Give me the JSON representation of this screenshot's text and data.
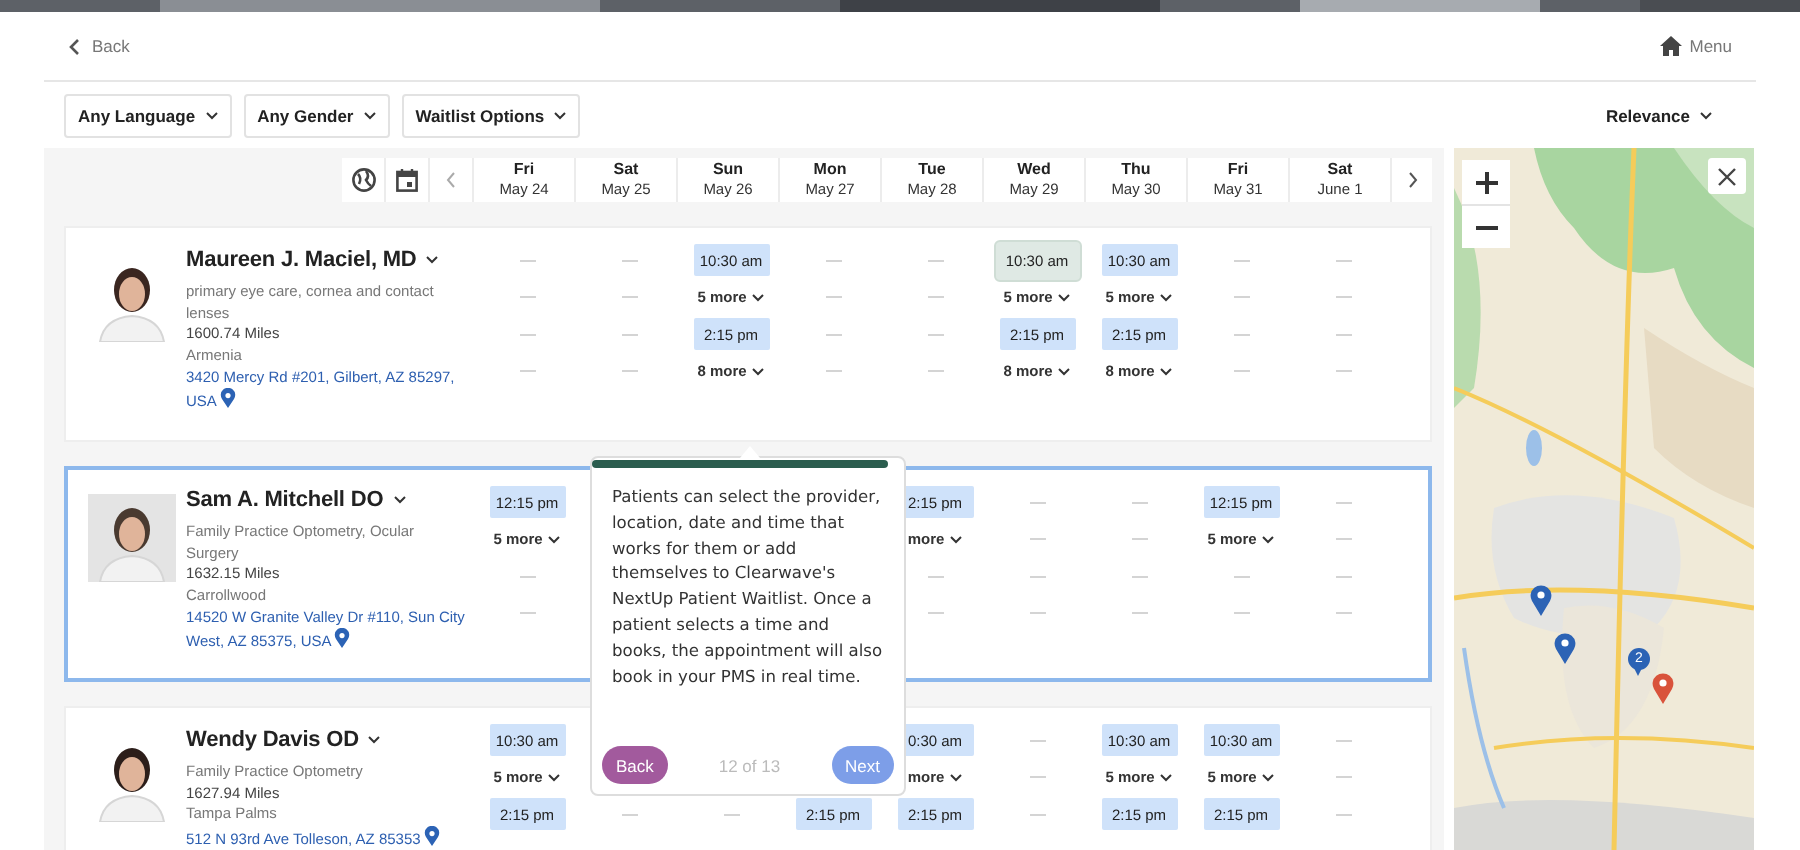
{
  "header": {
    "back": "Back",
    "menu": "Menu"
  },
  "filters": [
    {
      "label": "Any Language"
    },
    {
      "label": "Any Gender"
    },
    {
      "label": "Waitlist Options"
    }
  ],
  "sort": {
    "label": "Relevance"
  },
  "dates": [
    {
      "weekday": "Fri",
      "date": "May 24"
    },
    {
      "weekday": "Sat",
      "date": "May 25"
    },
    {
      "weekday": "Sun",
      "date": "May 26"
    },
    {
      "weekday": "Mon",
      "date": "May 27"
    },
    {
      "weekday": "Tue",
      "date": "May 28"
    },
    {
      "weekday": "Wed",
      "date": "May 29"
    },
    {
      "weekday": "Thu",
      "date": "May 30"
    },
    {
      "weekday": "Fri",
      "date": "May 31"
    },
    {
      "weekday": "Sat",
      "date": "June 1"
    }
  ],
  "providers": [
    {
      "name": "Maureen J. Maciel, MD",
      "selected": false,
      "specialty": "primary eye care, cornea and contact lenses",
      "distance": "1600.74 Miles",
      "area": "Armenia",
      "address": "3420 Mercy Rd #201, Gilbert, AZ 85297, USA",
      "days": [
        {
          "items": [
            {
              "kind": "dash"
            },
            {
              "kind": "dash"
            },
            {
              "kind": "dash"
            },
            {
              "kind": "dash"
            }
          ]
        },
        {
          "items": [
            {
              "kind": "dash"
            },
            {
              "kind": "dash"
            },
            {
              "kind": "dash"
            },
            {
              "kind": "dash"
            }
          ]
        },
        {
          "items": [
            {
              "kind": "slot",
              "time": "10:30 am",
              "selected": false
            },
            {
              "kind": "more",
              "label": "5 more"
            },
            {
              "kind": "slot",
              "time": "2:15 pm",
              "selected": false
            },
            {
              "kind": "more",
              "label": "8 more"
            }
          ]
        },
        {
          "items": [
            {
              "kind": "dash"
            },
            {
              "kind": "dash"
            },
            {
              "kind": "dash"
            },
            {
              "kind": "dash"
            }
          ]
        },
        {
          "items": [
            {
              "kind": "dash"
            },
            {
              "kind": "dash"
            },
            {
              "kind": "dash"
            },
            {
              "kind": "dash"
            }
          ]
        },
        {
          "items": [
            {
              "kind": "slot",
              "time": "10:30 am",
              "selected": true
            },
            {
              "kind": "more",
              "label": "5 more"
            },
            {
              "kind": "slot",
              "time": "2:15 pm",
              "selected": false
            },
            {
              "kind": "more",
              "label": "8 more"
            }
          ]
        },
        {
          "items": [
            {
              "kind": "slot",
              "time": "10:30 am",
              "selected": false
            },
            {
              "kind": "more",
              "label": "5 more"
            },
            {
              "kind": "slot",
              "time": "2:15 pm",
              "selected": false
            },
            {
              "kind": "more",
              "label": "8 more"
            }
          ]
        },
        {
          "items": [
            {
              "kind": "dash"
            },
            {
              "kind": "dash"
            },
            {
              "kind": "dash"
            },
            {
              "kind": "dash"
            }
          ]
        },
        {
          "items": [
            {
              "kind": "dash"
            },
            {
              "kind": "dash"
            },
            {
              "kind": "dash"
            },
            {
              "kind": "dash"
            }
          ]
        }
      ]
    },
    {
      "name": "Sam A. Mitchell DO",
      "selected": true,
      "specialty": "Family Practice Optometry, Ocular Surgery",
      "distance": "1632.15 Miles",
      "area": "Carrollwood",
      "address": "14520 W Granite Valley Dr #110, Sun City West, AZ 85375, USA",
      "days": [
        {
          "items": [
            {
              "kind": "slot",
              "time": "12:15 pm",
              "selected": false
            },
            {
              "kind": "more",
              "label": "5 more"
            },
            {
              "kind": "dash"
            },
            {
              "kind": "dash"
            }
          ]
        },
        {
          "items": [
            {
              "kind": "covered"
            },
            {
              "kind": "covered"
            },
            {
              "kind": "covered"
            },
            {
              "kind": "covered"
            }
          ]
        },
        {
          "items": [
            {
              "kind": "covered"
            },
            {
              "kind": "covered"
            },
            {
              "kind": "covered"
            },
            {
              "kind": "covered"
            }
          ]
        },
        {
          "items": [
            {
              "kind": "covered"
            },
            {
              "kind": "covered"
            },
            {
              "kind": "covered"
            },
            {
              "kind": "covered"
            }
          ]
        },
        {
          "items": [
            {
              "kind": "slot",
              "time": "2:15 pm",
              "selected": false
            },
            {
              "kind": "more",
              "label": "more"
            },
            {
              "kind": "dash"
            },
            {
              "kind": "dash"
            }
          ]
        },
        {
          "items": [
            {
              "kind": "dash"
            },
            {
              "kind": "dash"
            },
            {
              "kind": "dash"
            },
            {
              "kind": "dash"
            }
          ]
        },
        {
          "items": [
            {
              "kind": "dash"
            },
            {
              "kind": "dash"
            },
            {
              "kind": "dash"
            },
            {
              "kind": "dash"
            }
          ]
        },
        {
          "items": [
            {
              "kind": "slot",
              "time": "12:15 pm",
              "selected": false
            },
            {
              "kind": "more",
              "label": "5 more"
            },
            {
              "kind": "dash"
            },
            {
              "kind": "dash"
            }
          ]
        },
        {
          "items": [
            {
              "kind": "dash"
            },
            {
              "kind": "dash"
            },
            {
              "kind": "dash"
            },
            {
              "kind": "dash"
            }
          ]
        }
      ]
    },
    {
      "name": "Wendy Davis OD",
      "selected": false,
      "specialty": "Family Practice Optometry",
      "distance": "1627.94 Miles",
      "area": "Tampa Palms",
      "address": "512 N 93rd Ave Tolleson, AZ 85353",
      "days": [
        {
          "items": [
            {
              "kind": "slot",
              "time": "10:30 am",
              "selected": false
            },
            {
              "kind": "more",
              "label": "5 more"
            },
            {
              "kind": "slot",
              "time": "2:15 pm",
              "selected": false
            }
          ]
        },
        {
          "items": [
            {
              "kind": "covered"
            },
            {
              "kind": "covered"
            },
            {
              "kind": "dash"
            }
          ]
        },
        {
          "items": [
            {
              "kind": "covered"
            },
            {
              "kind": "covered"
            },
            {
              "kind": "dash"
            }
          ]
        },
        {
          "items": [
            {
              "kind": "covered"
            },
            {
              "kind": "covered"
            },
            {
              "kind": "slot",
              "time": "2:15 pm",
              "selected": false
            }
          ]
        },
        {
          "items": [
            {
              "kind": "slot",
              "time": "0:30 am",
              "selected": false
            },
            {
              "kind": "more",
              "label": "more"
            },
            {
              "kind": "slot",
              "time": "2:15 pm",
              "selected": false
            }
          ]
        },
        {
          "items": [
            {
              "kind": "dash"
            },
            {
              "kind": "dash"
            },
            {
              "kind": "dash"
            }
          ]
        },
        {
          "items": [
            {
              "kind": "slot",
              "time": "10:30 am",
              "selected": false
            },
            {
              "kind": "more",
              "label": "5 more"
            },
            {
              "kind": "slot",
              "time": "2:15 pm",
              "selected": false
            }
          ]
        },
        {
          "items": [
            {
              "kind": "slot",
              "time": "10:30 am",
              "selected": false
            },
            {
              "kind": "more",
              "label": "5 more"
            },
            {
              "kind": "slot",
              "time": "2:15 pm",
              "selected": false
            }
          ]
        },
        {
          "items": [
            {
              "kind": "dash"
            },
            {
              "kind": "dash"
            },
            {
              "kind": "dash"
            }
          ]
        }
      ]
    }
  ],
  "tour_popover": {
    "text": "Patients can select the provider, location, date and time that works for them or add themselves to Clearwave's NextUp Patient Waitlist. Once a patient selects a time and books, the appointment will also book in your PMS in real time.",
    "back": "Back",
    "progress": "12 of 13",
    "next": "Next"
  },
  "map": {
    "markers": [
      {
        "kind": "pin",
        "color": "#2c63b5"
      },
      {
        "kind": "pin",
        "color": "#2c63b5"
      },
      {
        "kind": "cluster",
        "count": "2",
        "color": "#2c63b5"
      },
      {
        "kind": "pin",
        "color": "#d9533b"
      }
    ]
  }
}
